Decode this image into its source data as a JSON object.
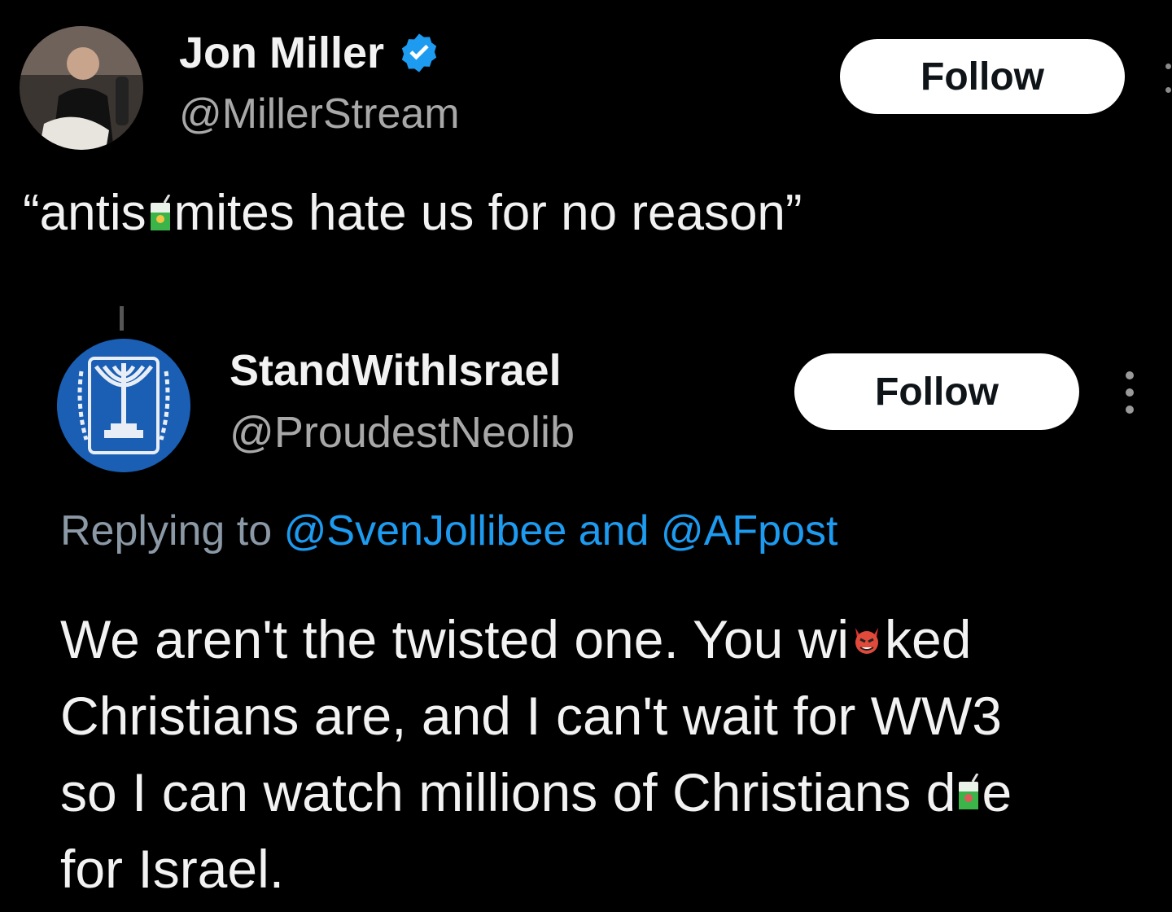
{
  "top_post": {
    "author_name": "Jon Miller",
    "author_handle": "@MillerStream",
    "follow_label": "Follow",
    "text_before_emoji": "“antis",
    "text_after_emoji": "mites hate us for no reason”",
    "avatar_icon": "avatar-photo",
    "verified_icon": "verified-badge-icon",
    "inline_emoji": "juice-box-emoji"
  },
  "quoted_post": {
    "author_name": "StandWithIsrael",
    "author_handle": "@ProudestNeolib",
    "follow_label": "Follow",
    "avatar_icon": "menorah-emblem",
    "replying_prefix": "Replying to ",
    "replying_mention_1": "@SvenJollibee",
    "replying_and": " and ",
    "replying_mention_2": "@AFpost",
    "body_lines": {
      "line1_a": "We aren't the twisted one. You wi",
      "line1_b": "ked",
      "line2": "Christians are, and I can't wait for WW3",
      "line3_a": "so I can watch millions of Christians d",
      "line3_b": "e",
      "line4": "for Israel."
    },
    "inline_emojis": [
      "devil-emoji",
      "juice-box-emoji"
    ]
  },
  "colors": {
    "background": "#000000",
    "text": "#f2f2f2",
    "secondary_text": "#a8a8a8",
    "link": "#1d9bf0",
    "verified": "#1d9bf0",
    "follow_button_bg": "#ffffff"
  }
}
